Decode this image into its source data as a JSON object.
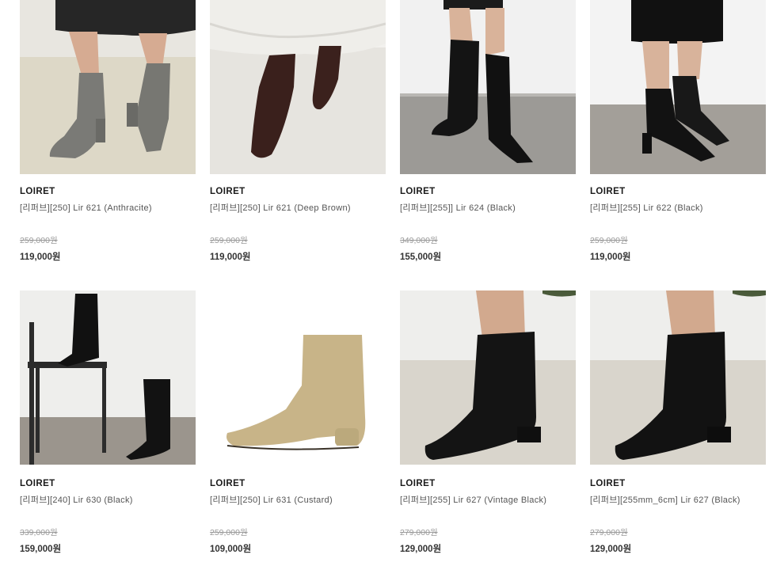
{
  "products": [
    {
      "brand": "LOIRET",
      "name": "[리퍼브][250] Lir 621 (Anthracite)",
      "original_price": "259,000원",
      "sale_price": "119,000원",
      "image": "gray-ankle-boots-photo"
    },
    {
      "brand": "LOIRET",
      "name": "[리퍼브][250] Lir 621 (Deep Brown)",
      "original_price": "259,000원",
      "sale_price": "119,000원",
      "image": "brown-ankle-boots-photo"
    },
    {
      "brand": "LOIRET",
      "name": "[리퍼브][255]] Lir 624 (Black)",
      "original_price": "349,000원",
      "sale_price": "155,000원",
      "image": "black-tall-western-boots-photo"
    },
    {
      "brand": "LOIRET",
      "name": "[리퍼브][255] Lir 622 (Black)",
      "original_price": "259,000원",
      "sale_price": "119,000원",
      "image": "black-ankle-boots-photo"
    },
    {
      "brand": "LOIRET",
      "name": "[리퍼브][240] Lir 630 (Black)",
      "original_price": "339,000원",
      "sale_price": "159,000원",
      "image": "black-knee-boots-chair-photo"
    },
    {
      "brand": "LOIRET",
      "name": "[리퍼브][250] Lir 631 (Custard)",
      "original_price": "259,000원",
      "sale_price": "109,000원",
      "image": "custard-ankle-boot-photo"
    },
    {
      "brand": "LOIRET",
      "name": "[리퍼브][255] Lir 627 (Vintage Black)",
      "original_price": "279,000원",
      "sale_price": "129,000원",
      "image": "vintage-black-boots-photo"
    },
    {
      "brand": "LOIRET",
      "name": "[리퍼브][255mm_6cm] Lir 627 (Black)",
      "original_price": "279,000원",
      "sale_price": "129,000원",
      "image": "black-square-toe-boots-photo"
    }
  ],
  "colors": {
    "brand_text": "#1a1a1a",
    "name_text": "#555555",
    "original_price": "#9a9a9a",
    "sale_price": "#333333"
  }
}
